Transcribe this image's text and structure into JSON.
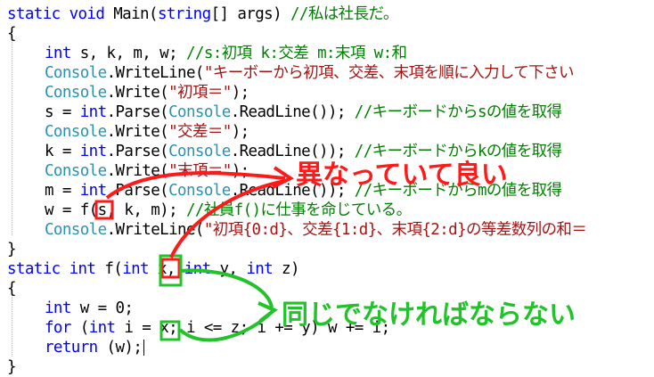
{
  "code": {
    "l1": {
      "kw1": "static",
      "kw2": "void",
      "name": "Main(",
      "type": "string",
      "rest": "[] args) ",
      "comment": "//私は社長だ。"
    },
    "l2": {
      "brace": "{"
    },
    "l3": {
      "kw": "int",
      "vars": " s, k, m, w; ",
      "comment": "//s:初項 k:交差 m:末項 w:和"
    },
    "l4": {
      "cls": "Console",
      "method": ".WriteLine(",
      "str": "\"キーボーから初項、交差、末項を順に入力して下さい"
    },
    "l5": {
      "cls": "Console",
      "method": ".Write(",
      "str": "\"初項＝\"",
      "end": ");"
    },
    "l6": {
      "pre": "s = ",
      "kw": "int",
      "mid": ".Parse(",
      "cls": "Console",
      "call": ".ReadLine()); ",
      "comment": "//キーボードからsの値を取得"
    },
    "l7": {
      "cls": "Console",
      "method": ".Write(",
      "str": "\"交差＝\"",
      "end": ");"
    },
    "l8": {
      "pre": "k = ",
      "kw": "int",
      "mid": ".Parse(",
      "cls": "Console",
      "call": ".ReadLine()); ",
      "comment": "//キーボードからkの値を取得"
    },
    "l9": {
      "cls": "Console",
      "method": ".Write(",
      "str": "\"末項＝\"",
      "end": ");"
    },
    "l10": {
      "pre": "m = ",
      "kw": "int",
      "mid": ".Parse(",
      "cls": "Console",
      "call": ".ReadLine()); ",
      "comment": "//キーボードからmの値を取得"
    },
    "l11": {
      "pre": "w = f(",
      "arg": "s",
      "post": ", k, m); ",
      "comment": "//社員f()に仕事を命じている。"
    },
    "l12": {
      "cls": "Console",
      "method": ".WriteLine(",
      "str": "\"初項{0:d}、交差{1:d}、末項{2:d}の等差数列の和＝"
    },
    "l13": {
      "brace": "}"
    },
    "l14": {
      "kw1": "static",
      "kw2": "int",
      "name": "f(",
      "kw3": "int",
      "param": "x",
      "c1": ", ",
      "kw4": "int",
      "p2": " y, ",
      "kw5": "int",
      "p3": " z)"
    },
    "l15": {
      "brace": "{"
    },
    "l16": {
      "kw": "int",
      "rest": " w = 0;"
    },
    "l17": {
      "kw1": "for",
      "open": " (",
      "kw2": "int",
      "a": " i = ",
      "x": "x",
      "b": "; i <= z; i += y) w += i;"
    },
    "l18": {
      "kw": "return",
      "rest": " (w);"
    },
    "l19": {
      "brace": "}"
    }
  },
  "annotations": {
    "red_note": "異なっていて良い",
    "green_note": "同じでなければならない"
  },
  "colors": {
    "keyword": "#0000ff",
    "type": "#2b91af",
    "string": "#a31515",
    "comment": "#008000",
    "red_annotation": "#ff1a1a",
    "green_annotation": "#22c22a"
  }
}
